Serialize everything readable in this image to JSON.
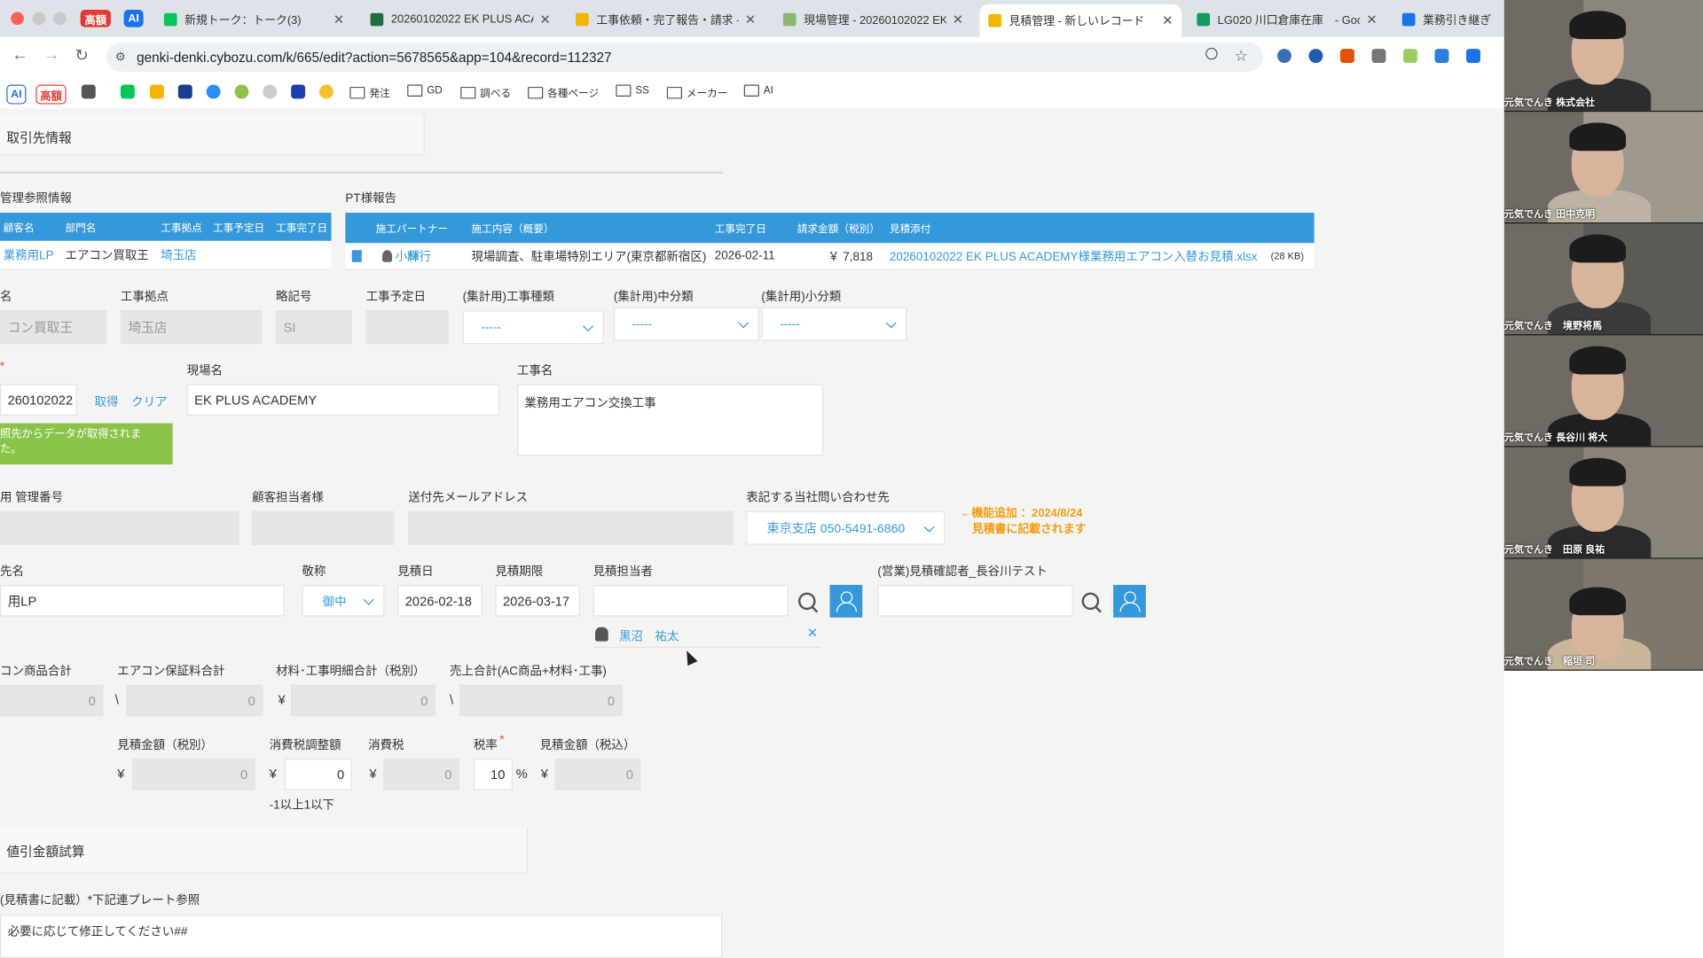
{
  "browser": {
    "badge_koukaku": "高額",
    "badge_ai": "AI",
    "tabs": [
      {
        "title": "新規トーク：トーク(3)",
        "color": "#06c755"
      },
      {
        "title": "20260102022 EK PLUS ACA",
        "color": "#1d6f42"
      },
      {
        "title": "工事依頼・完了報告・請求 - PT",
        "color": "#f2b600"
      },
      {
        "title": "現場管理 - 20260102022 EK",
        "color": "#8fb572"
      },
      {
        "title": "見積管理 - 新しいレコード",
        "color": "#f2b600"
      },
      {
        "title": "LG020 川口倉庫在庫　- Goog",
        "color": "#0f9d58"
      },
      {
        "title": "業務引き継ぎ",
        "color": "#1a73e8"
      }
    ],
    "url": "genki-denki.cybozu.com/k/665/edit?action=5678565&app=104&record=112327",
    "bookmarks": {
      "ai": "AI",
      "koukaku": "高額",
      "folders": [
        "発注",
        "GD",
        "調べる",
        "各種ページ",
        "SS",
        "メーカー",
        "AI"
      ]
    }
  },
  "form": {
    "section_torihiki": "取引先情報",
    "kanri_ref_title": "管理参照情報",
    "kanri_headers": [
      "顧客名",
      "部門名",
      "工事拠点",
      "工事予定日",
      "工事完了日"
    ],
    "kanri_row": {
      "customer": "業務用LP",
      "dept": "エアコン買取王",
      "base": "埼玉店"
    },
    "pt_title": "PT様報告",
    "pt_headers": [
      "施工パートナー",
      "施工内容（概要）",
      "工事完了日",
      "請求金額（税別）",
      "見積添付"
    ],
    "pt_row": {
      "partner_last": "小林",
      "partner_first": "輝行",
      "content": "現場調査、駐車場特別エリア(東京都新宿区)",
      "done_date": "2026-02-11",
      "amount": "￥ 7,818",
      "file": "20260102022 EK PLUS ACADEMY様業務用エアコン入替お見積.xlsx",
      "file_size": "(28 KB)"
    },
    "row1_labels": {
      "mei": "名",
      "base": "工事拠点",
      "abbr": "略記号",
      "schedule": "工事予定日",
      "type": "(集計用)工事種類",
      "mid": "(集計用)中分類",
      "small": "(集計用)小分類"
    },
    "row1_values": {
      "mei": "コン買取王",
      "base": "埼玉店",
      "abbr": "SI",
      "schedule": ""
    },
    "select_placeholder": "-----",
    "required_mark": "*",
    "genba_code": "260102022",
    "btn_get": "取得",
    "btn_clear": "クリア",
    "success_msg_1": "照先からデータが取得されま",
    "success_msg_2": "た。",
    "genba_label": "現場名",
    "genba_name": "EK PLUS ACADEMY",
    "kouji_label": "工事名",
    "kouji_name": "業務用エアコン交換工事",
    "row3_labels": {
      "kanri": "用 管理番号",
      "tanto": "顧客担当者様",
      "mail": "送付先メールアドレス",
      "contact": "表記する当社問い合わせ先"
    },
    "contact_value": "東京支店 050-5491-6860",
    "note_line1": "←機能追加 ：2024/8/24",
    "note_line2": "見積書に記載されます",
    "row4_labels": {
      "saki": "先名",
      "keisho": "敬称",
      "date": "見積日",
      "limit": "見積期限",
      "tanto": "見積担当者",
      "confirm": "(営業)見積確認者_長谷川テスト"
    },
    "saki_value": "用LP",
    "keisho_value": "御中",
    "mitsumori_date": "2026-02-18",
    "mitsumori_limit": "2026-03-17",
    "tanto_user": {
      "last": "黒沼",
      "first": "祐太"
    },
    "totals_labels": [
      "コン商品合計",
      "エアコン保証料合計",
      "材料･工事明細合計（税別）",
      "売上合計(AC商品+材料･工事)"
    ],
    "totals_values": [
      "0",
      "0",
      "0",
      "0"
    ],
    "currency_bs": "\\",
    "currency_yen": "¥",
    "tax_labels": {
      "amount": "見積金額（税別）",
      "adjust": "消費税調整額",
      "tax": "消費税",
      "rate": "税率",
      "total": "見積金額（税込）"
    },
    "tax_values": {
      "amount": "0",
      "adjust": "0",
      "tax": "0",
      "rate": "10",
      "total": "0"
    },
    "percent": "%",
    "adjust_hint": "-1以上1以下",
    "nebiki_title": "値引金額試算",
    "bikou_label": "(見積書に記載）*下記連プレート参照",
    "bikou_value": "必要に応じて修正してください##"
  },
  "participants": [
    "元気でんき 株式会社",
    "元気でんき 田中克明",
    "元気でんき　境野将馬",
    "元気でんき 長谷川 将大",
    "元気でんき　田原 良祐",
    "元気でんき　稲垣 司"
  ],
  "colors": {
    "accent": "#3498db",
    "success": "#8bc34a",
    "note": "#f39c12"
  }
}
